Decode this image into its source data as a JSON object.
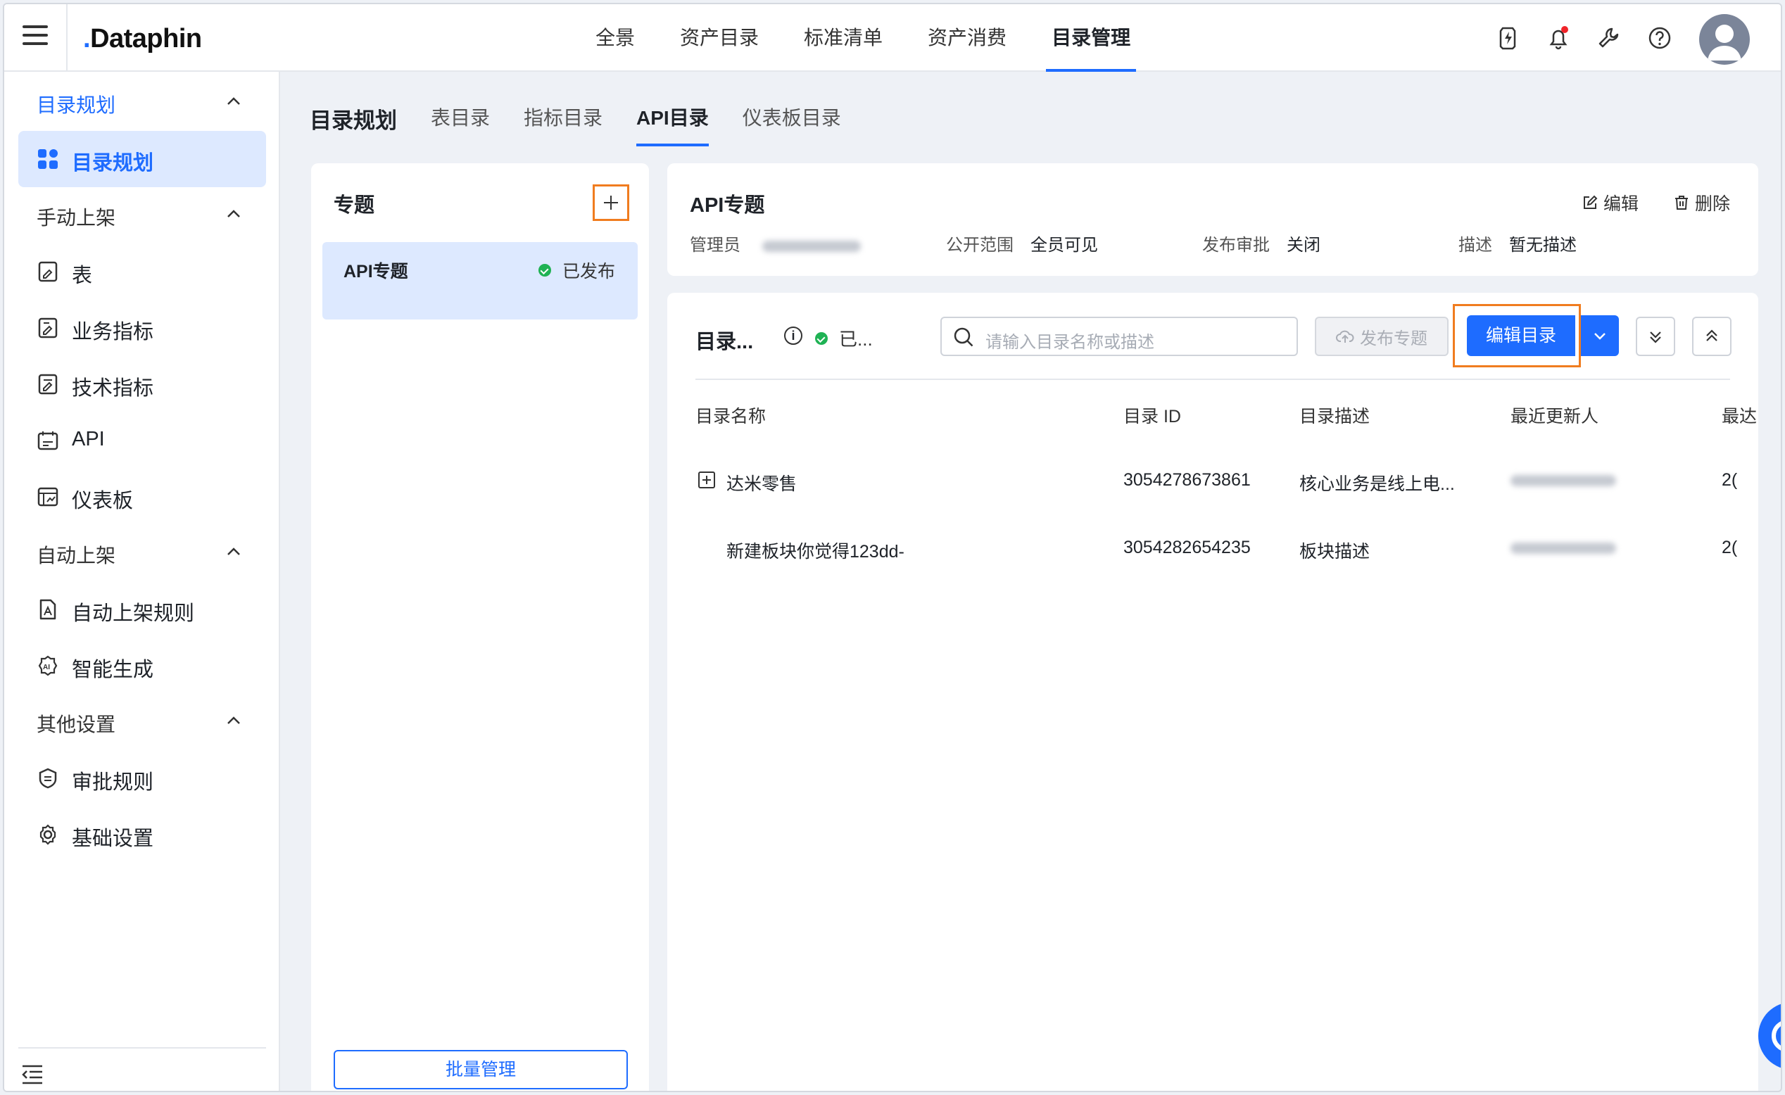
{
  "app": {
    "logo": "Dataphin"
  },
  "top_nav": [
    "全景",
    "资产目录",
    "标准清单",
    "资产消费",
    "目录管理"
  ],
  "top_nav_active": "目录管理",
  "sidebar": {
    "groups": [
      {
        "label": "目录规划"
      },
      {
        "label": "手动上架"
      },
      {
        "label": "自动上架"
      },
      {
        "label": "其他设置"
      }
    ],
    "items": [
      {
        "label": "目录规划",
        "icon": "grid-icon"
      },
      {
        "label": "表",
        "icon": "table-icon"
      },
      {
        "label": "业务指标",
        "icon": "business-metric-icon"
      },
      {
        "label": "技术指标",
        "icon": "tech-metric-icon"
      },
      {
        "label": "API",
        "icon": "api-icon"
      },
      {
        "label": "仪表板",
        "icon": "dashboard-icon"
      },
      {
        "label": "自动上架规则",
        "icon": "rule-doc-icon"
      },
      {
        "label": "智能生成",
        "icon": "ai-icon"
      },
      {
        "label": "审批规则",
        "icon": "approval-icon"
      },
      {
        "label": "基础设置",
        "icon": "gear-icon"
      }
    ]
  },
  "page_tabs": {
    "title": "目录规划",
    "tabs": [
      "表目录",
      "指标目录",
      "API目录",
      "仪表板目录"
    ],
    "active": "API目录"
  },
  "topic_panel": {
    "title": "专题",
    "topic": {
      "name": "API专题",
      "status": "已发布"
    },
    "batch_button": "批量管理"
  },
  "info_card": {
    "title": "API专题",
    "edit_label": "编辑",
    "delete_label": "删除",
    "admin_label": "管理员",
    "scope_label": "公开范围",
    "scope_value": "全员可见",
    "review_label": "发布审批",
    "review_value": "关闭",
    "desc_label": "描述",
    "desc_value": "暂无描述"
  },
  "catalog_table": {
    "title": "目录...",
    "status": "已...",
    "search_placeholder": "请输入目录名称或描述",
    "publish_button": "发布专题",
    "edit_button": "编辑目录",
    "columns": [
      "目录名称",
      "目录 ID",
      "目录描述",
      "最近更新人",
      "最达"
    ],
    "rows": [
      {
        "name": "达米零售",
        "id": "3054278673861",
        "desc": "核心业务是线上电...",
        "time": "2("
      },
      {
        "name": "新建板块你觉得123dd-",
        "id": "3054282654235",
        "desc": "板块描述",
        "time": "2("
      }
    ]
  },
  "colors": {
    "primary": "#1e6cff",
    "highlight": "#f07c1f",
    "success": "#1fb254"
  }
}
